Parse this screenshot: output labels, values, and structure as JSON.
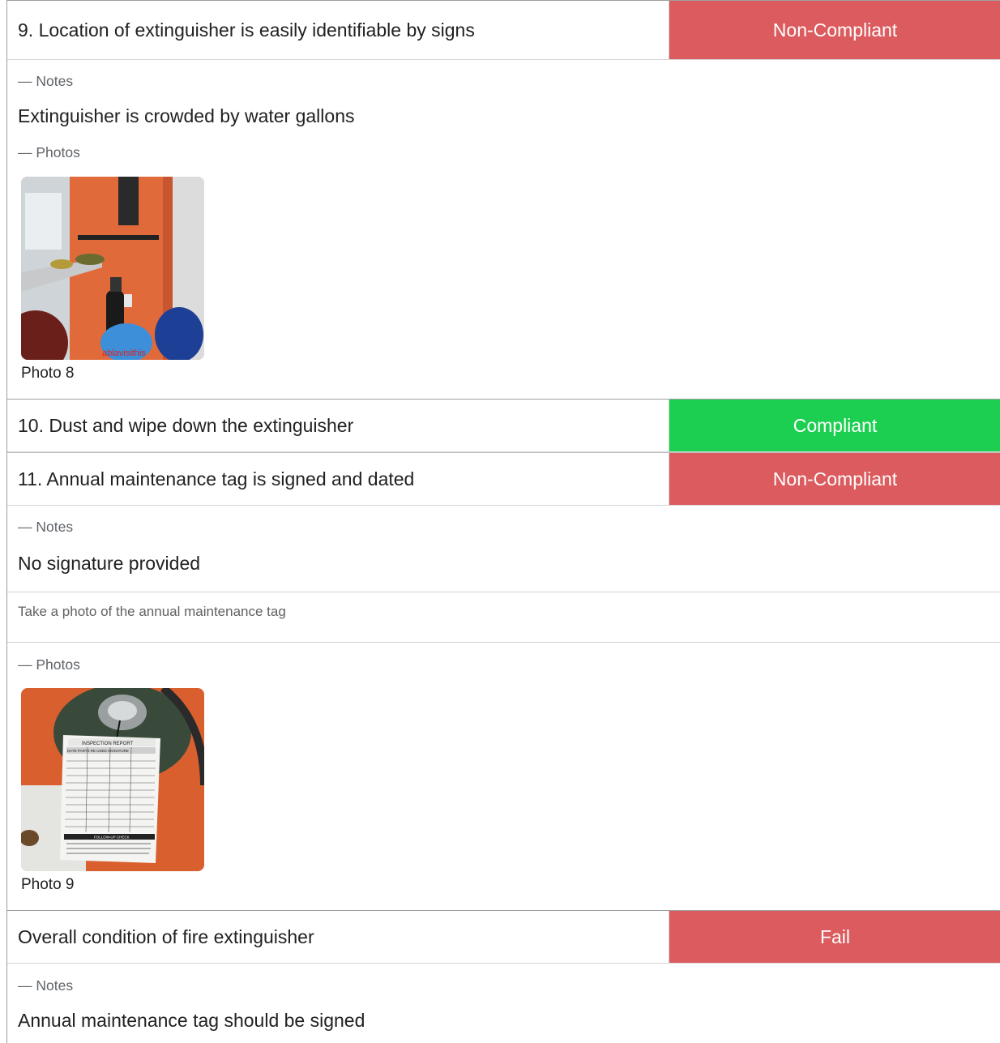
{
  "colors": {
    "noncompliant": "#DB5B5E",
    "compliant": "#1DCF51",
    "fail": "#DB5B5E"
  },
  "items": {
    "q9": {
      "text": "9. Location of extinguisher is easily identifiable by signs",
      "status": "Non-Compliant"
    },
    "q10": {
      "text": "10. Dust and wipe down the extinguisher",
      "status": "Compliant"
    },
    "q11": {
      "text": "11. Annual maintenance tag is signed and dated",
      "status": "Non-Compliant"
    },
    "overall": {
      "text": "Overall condition of fire extinguisher",
      "status": "Fail"
    }
  },
  "labels": {
    "notes": "— Notes",
    "photos": "— Photos"
  },
  "notes": {
    "q9": "Extinguisher is crowded by water gallons",
    "q11": "No signature provided",
    "overall": "Annual maintenance tag should be signed"
  },
  "instructions": {
    "q11": "Take a photo of the annual maintenance tag"
  },
  "photos": {
    "photo8": {
      "caption": "Photo 8",
      "icon": "fire-extinguisher-photo",
      "overlay": "ablavisithis"
    },
    "photo9": {
      "caption": "Photo 9",
      "icon": "maintenance-tag-photo",
      "tag_title": "INSPECTION REPORT",
      "tag_columns": "DATE   PARTS RE   USED   SIGNATURE",
      "tag_footer": "FOLLOW-UP CHECK"
    }
  }
}
